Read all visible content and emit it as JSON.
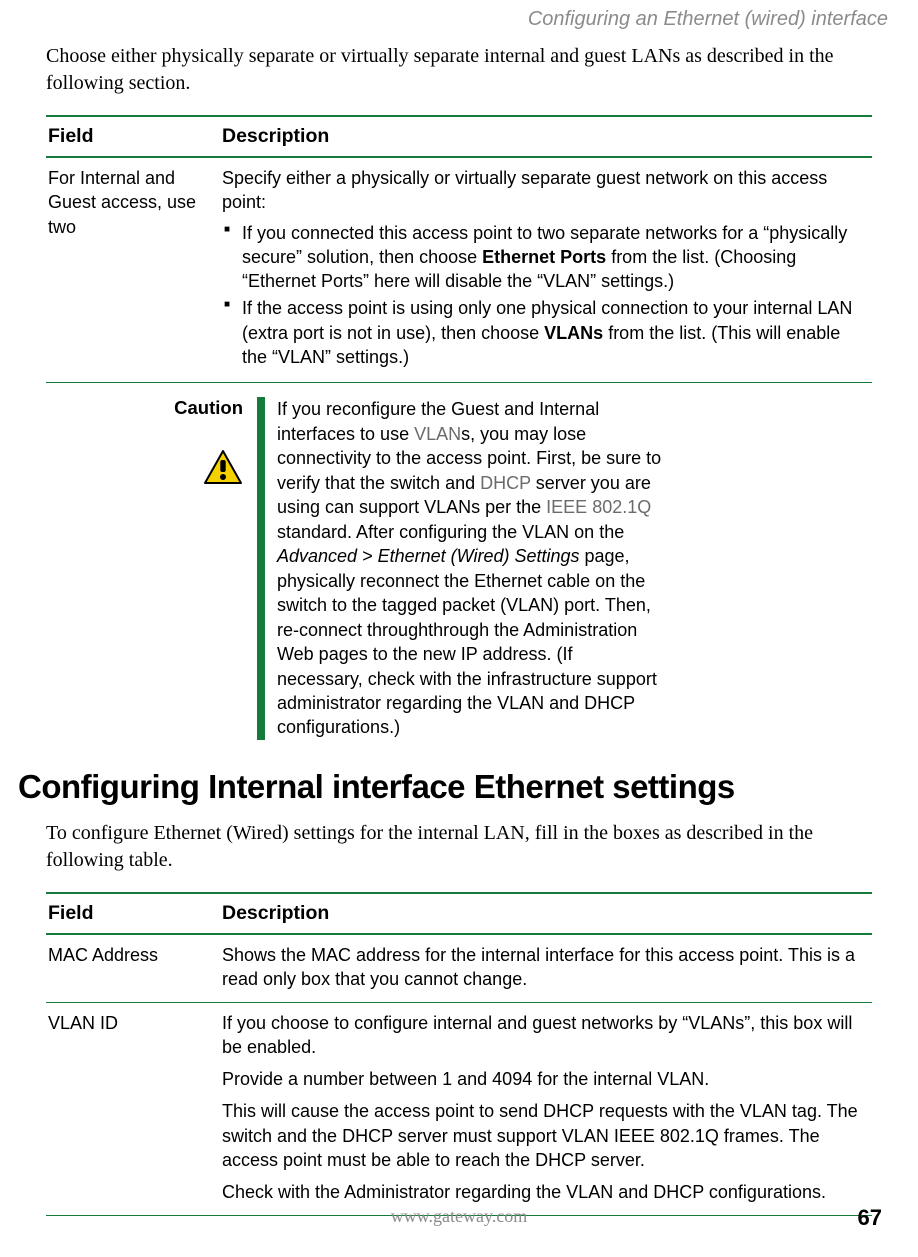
{
  "header": {
    "running": "Configuring an Ethernet (wired) interface"
  },
  "intro1": "Choose either physically separate or virtually separate internal and guest LANs as described in the following section.",
  "table1": {
    "col_field": "Field",
    "col_desc": "Description",
    "rows": [
      {
        "field": "For Internal and Guest access, use two",
        "desc_lead": "Specify either a physically or virtually separate guest network on this access point:",
        "bullets": [
          {
            "pre": "If you connected this access point to two separate networks for a “physically secure” solution, then choose ",
            "bold": "Ethernet Ports",
            "post": " from the list. (Choosing “Ethernet Ports” here will disable the “VLAN” settings.)"
          },
          {
            "pre": "If the access point is using only one physical connection to your internal LAN (extra port is not in use), then choose ",
            "bold": "VLANs",
            "post": " from the list. (This will enable the “VLAN” settings.)"
          }
        ]
      }
    ]
  },
  "caution": {
    "label": "Caution",
    "t1": "If you reconfigure the Guest and Internal interfaces to use ",
    "link1": "VLAN",
    "t2": "s, you may lose connectivity to the access point. First, be sure to verify that the switch and ",
    "link2": "DHCP",
    "t3": " server you are using can support VLANs per the ",
    "link3": "IEEE",
    "t3b": " ",
    "link4": "802.1Q",
    "t4": " standard. After configuring the VLAN on the ",
    "ital": "Advanced > Ethernet (Wired) Settings",
    "t5": " page, physically reconnect the Ethernet cable on the switch to the tagged packet (VLAN) port. Then, re-connect throughthrough the Administration Web pages to the new IP address. (If necessary, check with the infrastructure support administrator regarding the VLAN and DHCP configurations.)"
  },
  "heading2": "Configuring Internal interface Ethernet settings",
  "intro2": "To configure Ethernet (Wired) settings for the internal LAN, fill in the boxes as described in the following table.",
  "table2": {
    "col_field": "Field",
    "col_desc": "Description",
    "rows": [
      {
        "field": "MAC Address",
        "paras": [
          "Shows the MAC address for the internal interface for this access point. This is a read only box that you cannot change."
        ]
      },
      {
        "field": "VLAN ID",
        "paras": [
          "If you choose to configure internal and guest networks by “VLANs”, this box will be enabled.",
          "Provide a number between 1 and 4094 for the internal VLAN.",
          "This will cause the access point to send DHCP requests with the VLAN tag. The switch and the DHCP server must support VLAN IEEE 802.1Q frames. The access point must be able to reach the DHCP server.",
          "Check with the Administrator regarding the VLAN and DHCP configurations."
        ]
      }
    ]
  },
  "footer": {
    "url": "www.gateway.com",
    "page": "67"
  }
}
